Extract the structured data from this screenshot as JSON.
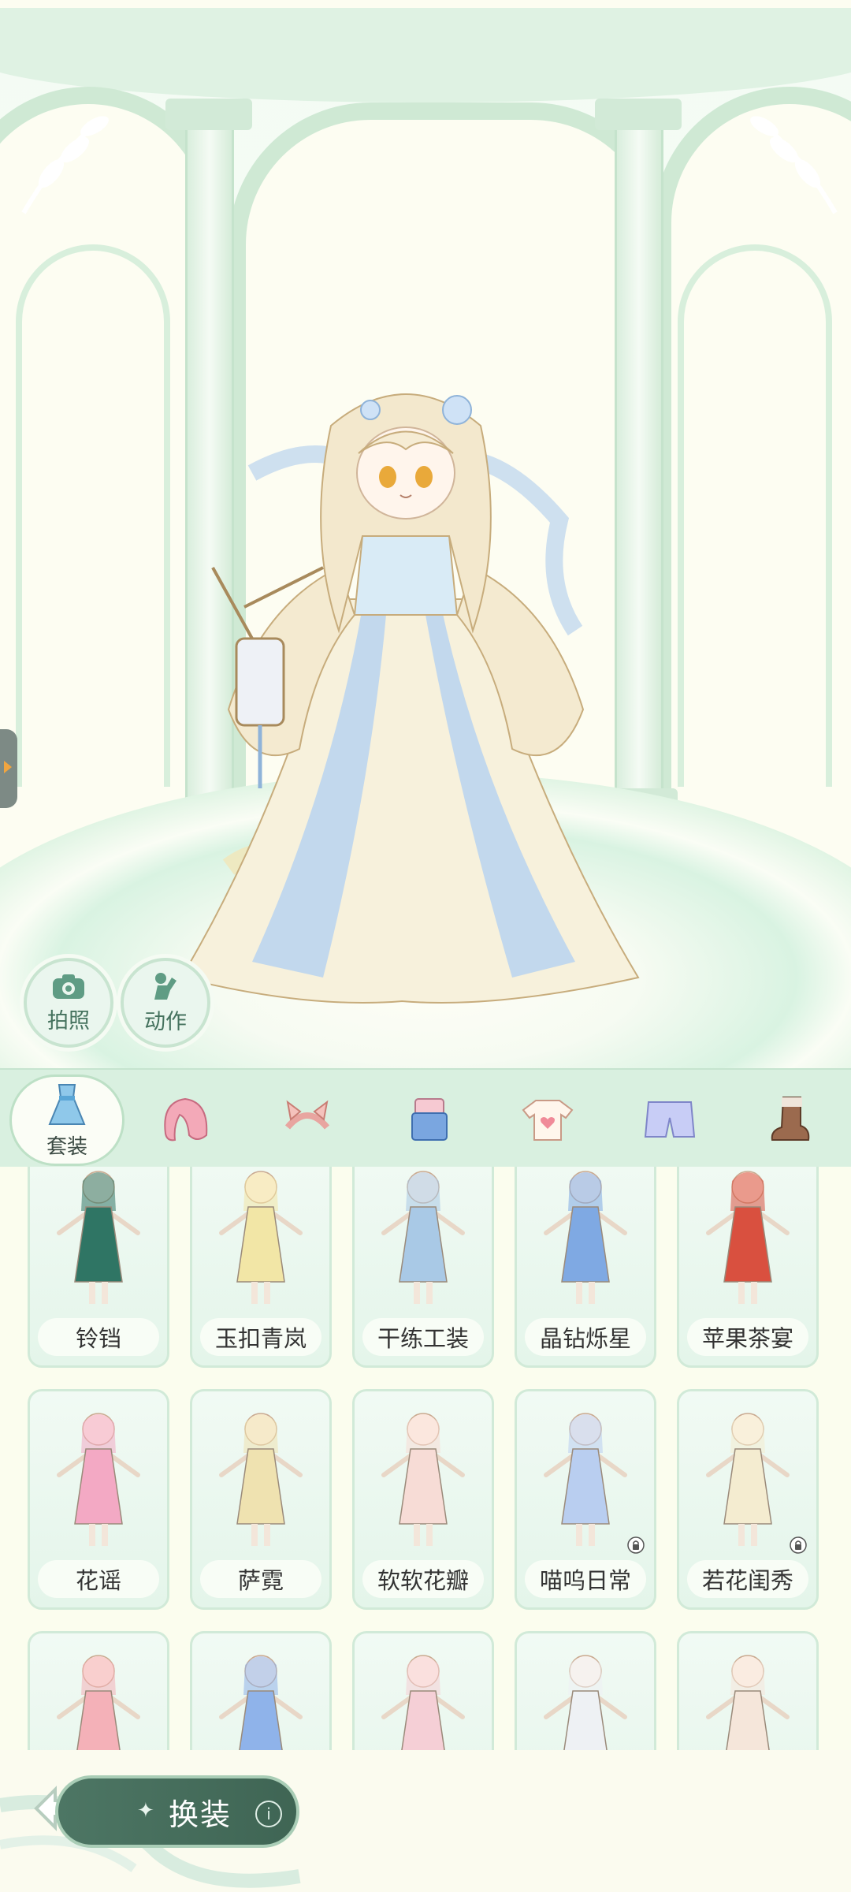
{
  "stage": {
    "photo_label": "拍照",
    "action_label": "动作"
  },
  "tabs": [
    {
      "label": "套装",
      "icon": "outfit-dress-icon",
      "active": true
    },
    {
      "label": "",
      "icon": "hair-icon"
    },
    {
      "label": "",
      "icon": "cat-ears-headwear-icon"
    },
    {
      "label": "",
      "icon": "overalls-icon"
    },
    {
      "label": "",
      "icon": "heart-tshirt-icon"
    },
    {
      "label": "",
      "icon": "shorts-icon"
    },
    {
      "label": "",
      "icon": "boots-icon"
    }
  ],
  "outfits": [
    {
      "name": "铃铛",
      "color": "#2f7564",
      "locked": false
    },
    {
      "name": "玉扣青岚",
      "color": "#f2e6a6",
      "locked": false
    },
    {
      "name": "干练工装",
      "color": "#a9c9e6",
      "locked": false
    },
    {
      "name": "晶钻烁星",
      "color": "#7fa9e3",
      "locked": false
    },
    {
      "name": "苹果茶宴",
      "color": "#d9503f",
      "locked": false
    },
    {
      "name": "花谣",
      "color": "#f3a9c4",
      "locked": false
    },
    {
      "name": "萨霓",
      "color": "#efe2b0",
      "locked": false
    },
    {
      "name": "软软花瓣",
      "color": "#f7dcd6",
      "locked": false
    },
    {
      "name": "喵呜日常",
      "color": "#b9cef0",
      "locked": true
    },
    {
      "name": "若花闺秀",
      "color": "#f4ecd0",
      "locked": true
    },
    {
      "name": "",
      "color": "#f4b1b8",
      "locked": false
    },
    {
      "name": "",
      "color": "#8fb3ea",
      "locked": false
    },
    {
      "name": "",
      "color": "#f5cfd6",
      "locked": false
    },
    {
      "name": "",
      "color": "#eef1f4",
      "locked": false
    },
    {
      "name": "",
      "color": "#f5e6da",
      "locked": false
    }
  ],
  "bottom": {
    "change_label": "换装",
    "info_symbol": "i"
  }
}
